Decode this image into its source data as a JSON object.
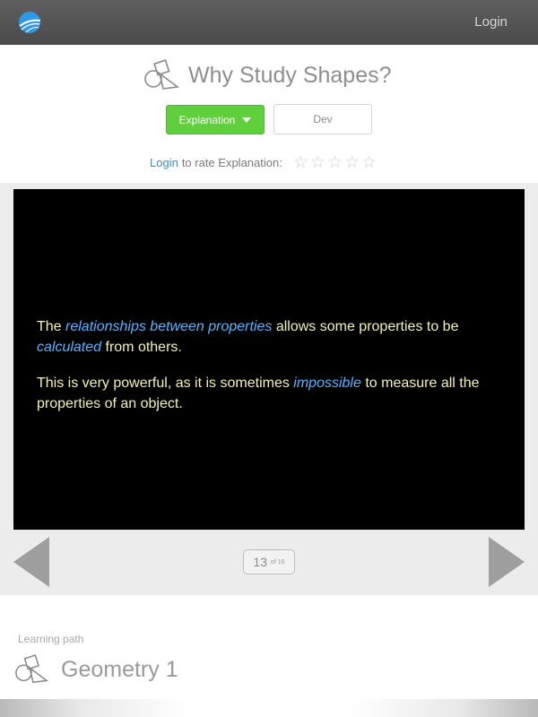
{
  "topbar": {
    "logo_icon": "globe-swoosh-icon",
    "login_label": "Login"
  },
  "header": {
    "title_icon": "shapes-icon",
    "title": "Why Study Shapes?",
    "tabs": {
      "explanation_label": "Explanation",
      "dev_label": "Dev"
    },
    "rating": {
      "login_label": "Login",
      "prompt": "to rate Explanation:",
      "stars_total": 5,
      "stars_filled": 0
    }
  },
  "slide": {
    "p1": {
      "a": "The ",
      "b": "relationships between properties",
      "c": " allows some properties to be ",
      "d": "calculated",
      "e": " from others."
    },
    "p2": {
      "a": "This is very powerful, as it is sometimes ",
      "b": "impossible",
      "c": " to measure all the properties of an object."
    }
  },
  "pager": {
    "current": "13",
    "of": "of 16"
  },
  "learning_path": {
    "label": "Learning path",
    "icon": "shapes-icon",
    "title": "Geometry 1"
  },
  "colors": {
    "topbar": "#555555",
    "accent_green": "#5fcf3c",
    "link_blue": "#2c8fd6",
    "slide_text": "#f6f2b4",
    "slide_highlight": "#58b4ff"
  }
}
